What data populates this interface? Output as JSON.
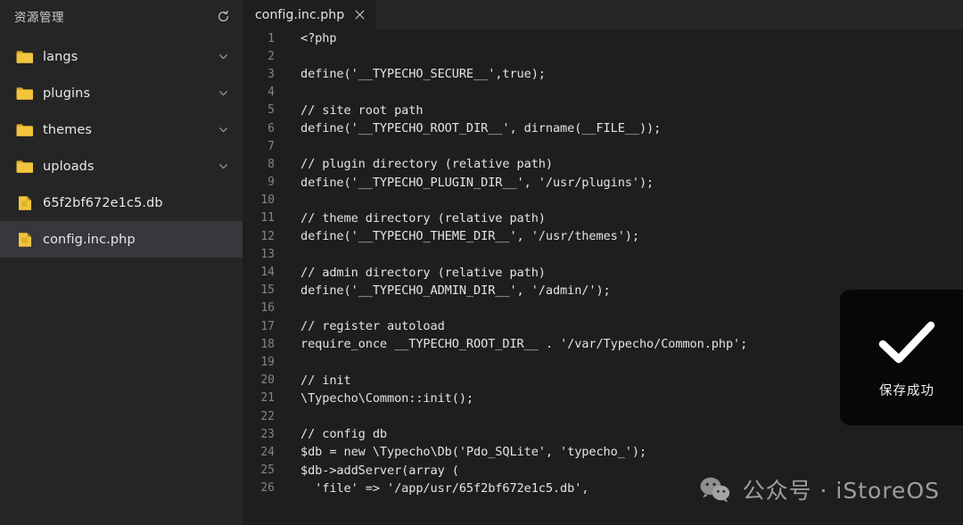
{
  "sidebar": {
    "title": "资源管理",
    "refresh_icon": "refresh-icon",
    "items": [
      {
        "label": "langs",
        "type": "folder",
        "icon": "folder-icon",
        "expandable": true,
        "selected": false
      },
      {
        "label": "plugins",
        "type": "folder",
        "icon": "folder-icon",
        "expandable": true,
        "selected": false
      },
      {
        "label": "themes",
        "type": "folder",
        "icon": "folder-icon",
        "expandable": true,
        "selected": false
      },
      {
        "label": "uploads",
        "type": "folder",
        "icon": "folder-icon",
        "expandable": true,
        "selected": false
      },
      {
        "label": "65f2bf672e1c5.db",
        "type": "file",
        "icon": "file-icon",
        "expandable": false,
        "selected": false
      },
      {
        "label": "config.inc.php",
        "type": "file",
        "icon": "file-icon",
        "expandable": false,
        "selected": true
      }
    ]
  },
  "editor": {
    "tab": {
      "label": "config.inc.php",
      "close_icon": "close-icon",
      "active": true
    },
    "lines": [
      {
        "n": "1",
        "text": "<?php"
      },
      {
        "n": "2",
        "text": ""
      },
      {
        "n": "3",
        "text": "define('__TYPECHO_SECURE__',true);"
      },
      {
        "n": "4",
        "text": ""
      },
      {
        "n": "5",
        "text": "// site root path"
      },
      {
        "n": "6",
        "text": "define('__TYPECHO_ROOT_DIR__', dirname(__FILE__));"
      },
      {
        "n": "7",
        "text": ""
      },
      {
        "n": "8",
        "text": "// plugin directory (relative path)"
      },
      {
        "n": "9",
        "text": "define('__TYPECHO_PLUGIN_DIR__', '/usr/plugins');"
      },
      {
        "n": "10",
        "text": ""
      },
      {
        "n": "11",
        "text": "// theme directory (relative path)"
      },
      {
        "n": "12",
        "text": "define('__TYPECHO_THEME_DIR__', '/usr/themes');"
      },
      {
        "n": "13",
        "text": ""
      },
      {
        "n": "14",
        "text": "// admin directory (relative path)"
      },
      {
        "n": "15",
        "text": "define('__TYPECHO_ADMIN_DIR__', '/admin/');"
      },
      {
        "n": "16",
        "text": ""
      },
      {
        "n": "17",
        "text": "// register autoload"
      },
      {
        "n": "18",
        "text": "require_once __TYPECHO_ROOT_DIR__ . '/var/Typecho/Common.php';"
      },
      {
        "n": "19",
        "text": ""
      },
      {
        "n": "20",
        "text": "// init"
      },
      {
        "n": "21",
        "text": "\\Typecho\\Common::init();"
      },
      {
        "n": "22",
        "text": ""
      },
      {
        "n": "23",
        "text": "// config db"
      },
      {
        "n": "24",
        "text": "$db = new \\Typecho\\Db('Pdo_SQLite', 'typecho_');"
      },
      {
        "n": "25",
        "text": "$db->addServer(array ("
      },
      {
        "n": "26",
        "text": "  'file' => '/app/usr/65f2bf672e1c5.db',"
      }
    ]
  },
  "toast": {
    "message": "保存成功",
    "icon": "check-icon"
  },
  "watermark": {
    "icon": "wechat-icon",
    "text": "公众号 · iStoreOS"
  },
  "colors": {
    "editor_bg": "#1e1e1e",
    "sidebar_bg": "#252526",
    "selected_row": "#37373d",
    "folder_yellow": "#e8bb3a",
    "line_number": "#858585",
    "code_text": "#e4e4e4"
  }
}
